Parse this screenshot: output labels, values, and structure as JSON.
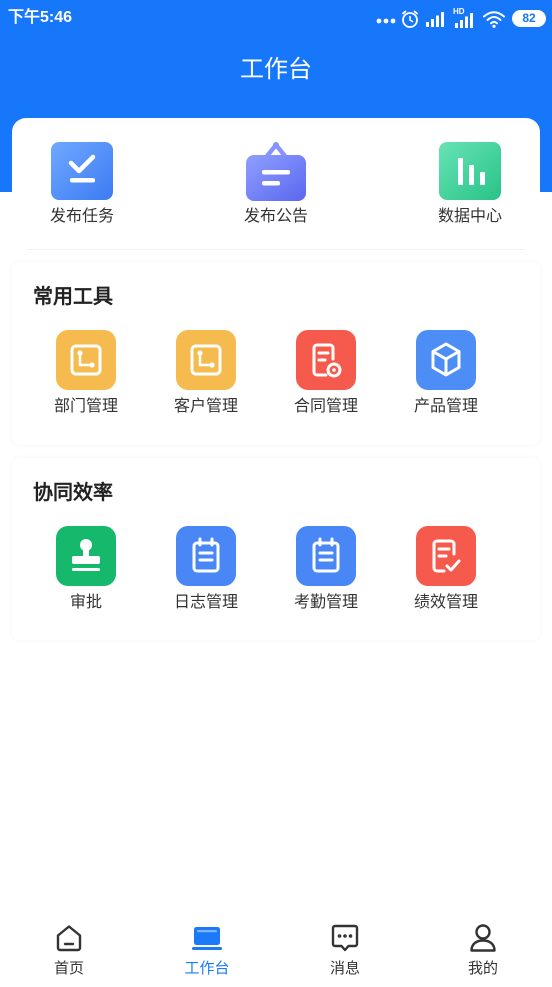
{
  "status_bar": {
    "time": "下午5:46",
    "hd_label": "HD",
    "battery_level": "82"
  },
  "header": {
    "title": "工作台",
    "background": "#1677FA"
  },
  "quick_actions": [
    {
      "label": "发布任务",
      "icon": "task-check-icon",
      "colors": [
        "#70A8FF",
        "#3C7BF3"
      ]
    },
    {
      "label": "发布公告",
      "icon": "announcement-icon",
      "colors": [
        "#909FFF",
        "#5A67EF"
      ],
      "handle_color": "#8594FC"
    },
    {
      "label": "数据中心",
      "icon": "data-chart-icon",
      "colors": [
        "#67E3B5",
        "#28C388"
      ]
    }
  ],
  "sections": [
    {
      "title": "常用工具",
      "items": [
        {
          "label": "部门管理",
          "icon": "department-icon",
          "color": "#F6BB4E"
        },
        {
          "label": "客户管理",
          "icon": "customer-icon",
          "color": "#F6BB4E"
        },
        {
          "label": "合同管理",
          "icon": "contract-icon",
          "color": "#F65A4C"
        },
        {
          "label": "产品管理",
          "icon": "product-cube-icon",
          "color": "#4D8DF6"
        }
      ]
    },
    {
      "title": "协同效率",
      "items": [
        {
          "label": "审批",
          "icon": "approval-stamp-icon",
          "color": "#16B96B"
        },
        {
          "label": "日志管理",
          "icon": "log-clipboard-icon",
          "color": "#4A87F6"
        },
        {
          "label": "考勤管理",
          "icon": "attendance-clipboard-icon",
          "color": "#4A87F6"
        },
        {
          "label": "绩效管理",
          "icon": "performance-doc-icon",
          "color": "#F65A4C"
        }
      ]
    }
  ],
  "tab_bar": {
    "active_color": "#1A7AF8",
    "inactive_color": "#333333",
    "items": [
      {
        "label": "首页",
        "icon": "home-icon",
        "active": false
      },
      {
        "label": "工作台",
        "icon": "workbench-laptop-icon",
        "active": true
      },
      {
        "label": "消息",
        "icon": "message-icon",
        "active": false
      },
      {
        "label": "我的",
        "icon": "profile-icon",
        "active": false
      }
    ]
  }
}
